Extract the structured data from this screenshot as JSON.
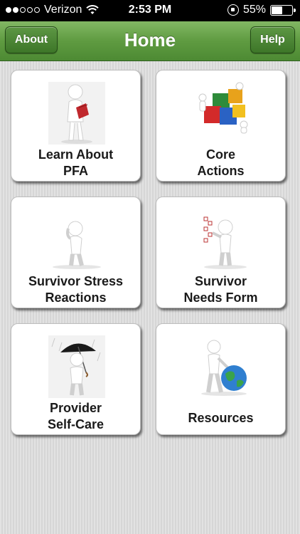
{
  "status_bar": {
    "carrier": "Verizon",
    "time": "2:53 PM",
    "battery_percent_label": "55%",
    "battery_level": 0.55,
    "signal_bars_filled": 2,
    "signal_bars_total": 5
  },
  "nav": {
    "title": "Home",
    "left_button": "About",
    "right_button": "Help",
    "colors": {
      "bar": "#5f9b41",
      "button": "#3d7628"
    }
  },
  "tiles": [
    {
      "label": "Learn About\nPFA",
      "icon": "figure-reading-book-icon"
    },
    {
      "label": "Core\nActions",
      "icon": "figures-assembling-cubes-icon"
    },
    {
      "label": "Survivor Stress\nReactions",
      "icon": "stressed-figure-icon"
    },
    {
      "label": "Survivor\nNeeds Form",
      "icon": "figure-with-checklist-icon"
    },
    {
      "label": "Provider\nSelf-Care",
      "icon": "figure-with-umbrella-icon"
    },
    {
      "label": "Resources",
      "icon": "figure-leaning-on-globe-icon"
    }
  ]
}
